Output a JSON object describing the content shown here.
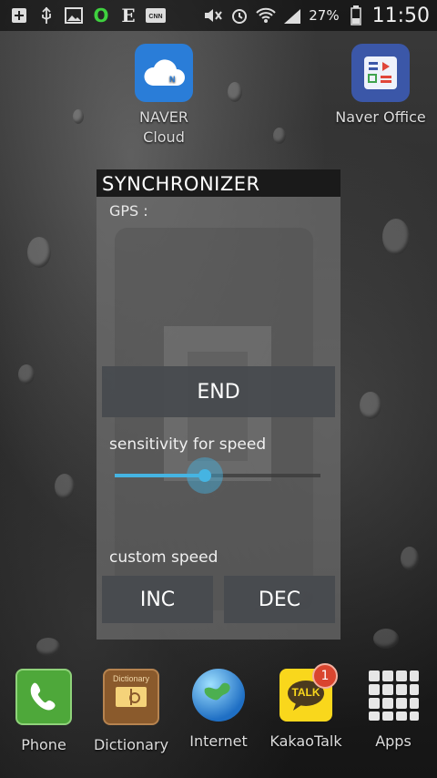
{
  "status_bar": {
    "battery_percent": "27%",
    "time": "11:50",
    "notification_icons": [
      "add-icon",
      "usb-icon",
      "image-icon",
      "o-icon",
      "e-icon",
      "cnn-icon"
    ],
    "system_icons": [
      "mute-icon",
      "alarm-icon",
      "wifi-icon",
      "signal-icon",
      "battery-icon"
    ]
  },
  "desktop": {
    "apps": [
      {
        "label_line1": "NAVER",
        "label_line2": "Cloud",
        "icon": "cloud-icon",
        "color": "#2a7dd8"
      },
      {
        "label_line1": "Naver Office",
        "label_line2": "",
        "icon": "office-icon",
        "color": "#3b57a8"
      }
    ]
  },
  "dialog": {
    "title": "SYNCHRONIZER",
    "gps_label": "GPS :",
    "end_label": "END",
    "sensitivity_label": "sensitivity for speed",
    "sensitivity_value_fraction": 0.44,
    "custom_speed_label": "custom speed",
    "inc_label": "INC",
    "dec_label": "DEC",
    "accent_color": "#45b4e2"
  },
  "dock": {
    "items": [
      {
        "label": "Phone",
        "icon": "phone-icon"
      },
      {
        "label": "Dictionary",
        "icon": "dictionary-icon",
        "icon_text": "Dictionary"
      },
      {
        "label": "Internet",
        "icon": "globe-icon"
      },
      {
        "label": "KakaoTalk",
        "icon": "kakaotalk-icon",
        "icon_text": "TALK",
        "badge": "1"
      },
      {
        "label": "Apps",
        "icon": "apps-grid-icon"
      }
    ]
  }
}
